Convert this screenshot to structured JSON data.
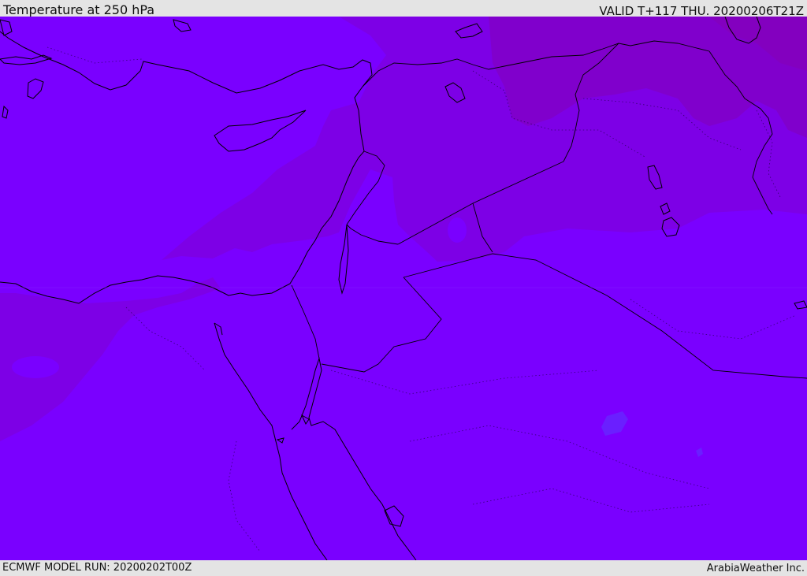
{
  "header": {
    "title": "Temperature at 250 hPa",
    "valid": "VALID T+117 THU. 20200206T21Z"
  },
  "footer": {
    "model_run": "ECMWF MODEL RUN: 20200202T00Z",
    "credit": "ArabiaWeather Inc."
  },
  "map": {
    "field": "Temperature at 250 hPa",
    "colors": {
      "background_band": "#7a00ff",
      "warmer_band": "#7d00e6",
      "warmest_band": "#8000cc",
      "small_anomaly": "#6a1fff",
      "coastline": "#000000",
      "borders": "#000000",
      "frame": "#e4e4e4"
    }
  }
}
